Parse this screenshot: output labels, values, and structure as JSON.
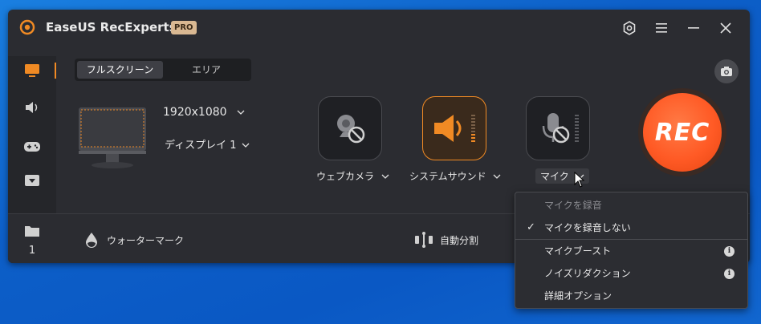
{
  "app": {
    "name": "EaseUS RecExperts",
    "badge": "PRO"
  },
  "tabs": [
    {
      "label": "フルスクリーン",
      "active": true
    },
    {
      "label": "エリア",
      "active": false
    }
  ],
  "screen": {
    "resolution": "1920x1080",
    "display": "ディスプレイ 1"
  },
  "sources": [
    {
      "label": "ウェブカメラ",
      "enabled": false
    },
    {
      "label": "システムサウンド",
      "enabled": true
    },
    {
      "label": "マイク",
      "enabled": false
    }
  ],
  "rec": {
    "label": "REC"
  },
  "sidebar": {
    "folder_count": "1"
  },
  "bottom": {
    "watermark": "ウォーターマーク",
    "autosplit": "自動分割"
  },
  "mic_menu": {
    "header": "マイクを録音",
    "items": [
      {
        "label": "マイクを録音しない",
        "checked": true
      },
      {
        "label": "マイクブースト",
        "info": true
      },
      {
        "label": "ノイズリダクション",
        "info": true
      },
      {
        "label": "詳細オプション",
        "info": false
      }
    ]
  },
  "colors": {
    "accent": "#f08a24",
    "rec": "#ff5a25",
    "panel": "#2b2c31"
  }
}
